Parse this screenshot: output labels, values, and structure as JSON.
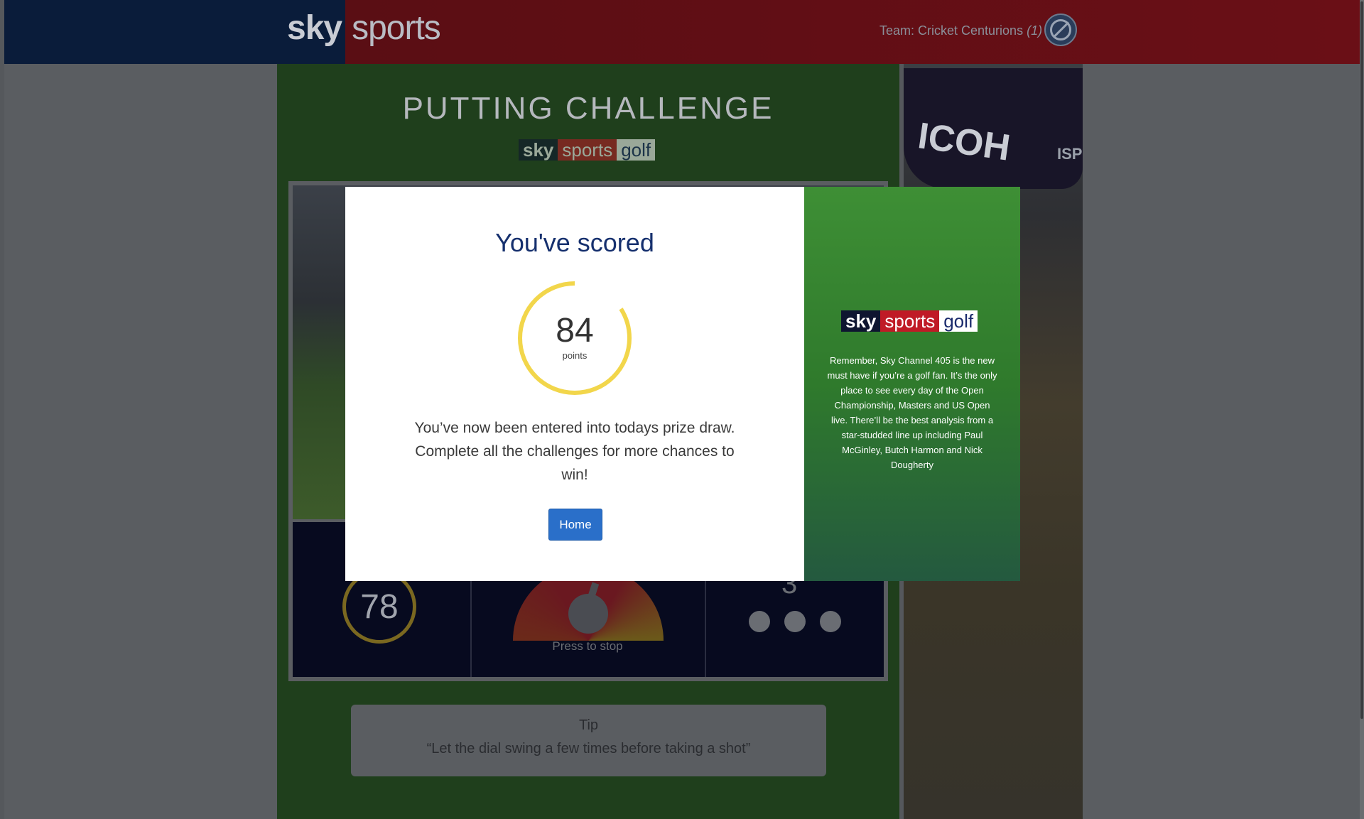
{
  "header": {
    "logo_sky": "sky",
    "logo_sports": "sports",
    "team_label": "Team: Cricket Centurions",
    "team_count": "(1)"
  },
  "challenge": {
    "title": "PUTTING CHALLENGE",
    "brand": {
      "sky": "sky",
      "sports": "sports",
      "golf": "golf"
    },
    "previous_score": "78",
    "dial_label": "Press to stop",
    "shots_left": "3",
    "shots_left_dots": 3
  },
  "tip": {
    "title": "Tip",
    "text": "“Let the dial swing a few times before taking a shot”"
  },
  "modal": {
    "title": "You've scored",
    "score": "84",
    "score_unit": "points",
    "score_ring_fraction": 0.84,
    "message": "You’ve now been entered into todays prize draw. Complete all the challenges for more chances to win!",
    "home_button": "Home",
    "promo_brand": {
      "sky": "sky",
      "sports": "sports",
      "golf": "golf"
    },
    "promo_text": "Remember, Sky Channel 405 is the new must have if you’re a golf fan. It’s the only place to see every day of the Open Championship, Masters and US Open live. There’ll be the best analysis from a star-studded line up including Paul McGinley, Butch Harmon and Nick Dougherty"
  },
  "photo": {
    "cap_text": "ICOH",
    "cap_text2": "ISPS HAN"
  },
  "colors": {
    "ring": "#f2d64b",
    "home_button": "#2a6fc9",
    "modal_title": "#16306e"
  }
}
